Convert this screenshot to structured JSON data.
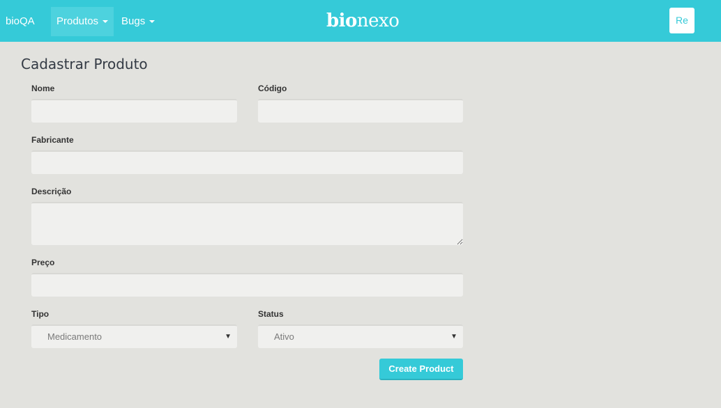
{
  "navbar": {
    "brand": "bioQA",
    "menus": [
      {
        "label": "Produtos",
        "active": true
      },
      {
        "label": "Bugs",
        "active": false
      }
    ],
    "logo": {
      "bold": "bio",
      "light": "nexo"
    },
    "user_initials": "Re",
    "accent_color": "#35cad8"
  },
  "form": {
    "title": "Cadastrar Produto",
    "fields": {
      "nome": {
        "label": "Nome",
        "value": ""
      },
      "codigo": {
        "label": "Código",
        "value": ""
      },
      "fabricante": {
        "label": "Fabricante",
        "value": ""
      },
      "descricao": {
        "label": "Descrição",
        "value": ""
      },
      "preco": {
        "label": "Preço",
        "value": ""
      },
      "tipo": {
        "label": "Tipo",
        "selected": "Medicamento"
      },
      "status": {
        "label": "Status",
        "selected": "Ativo"
      }
    },
    "submit_label": "Create Product"
  },
  "icons": {
    "dropdown": "caret-down-icon",
    "select": "select-arrow-icon"
  }
}
